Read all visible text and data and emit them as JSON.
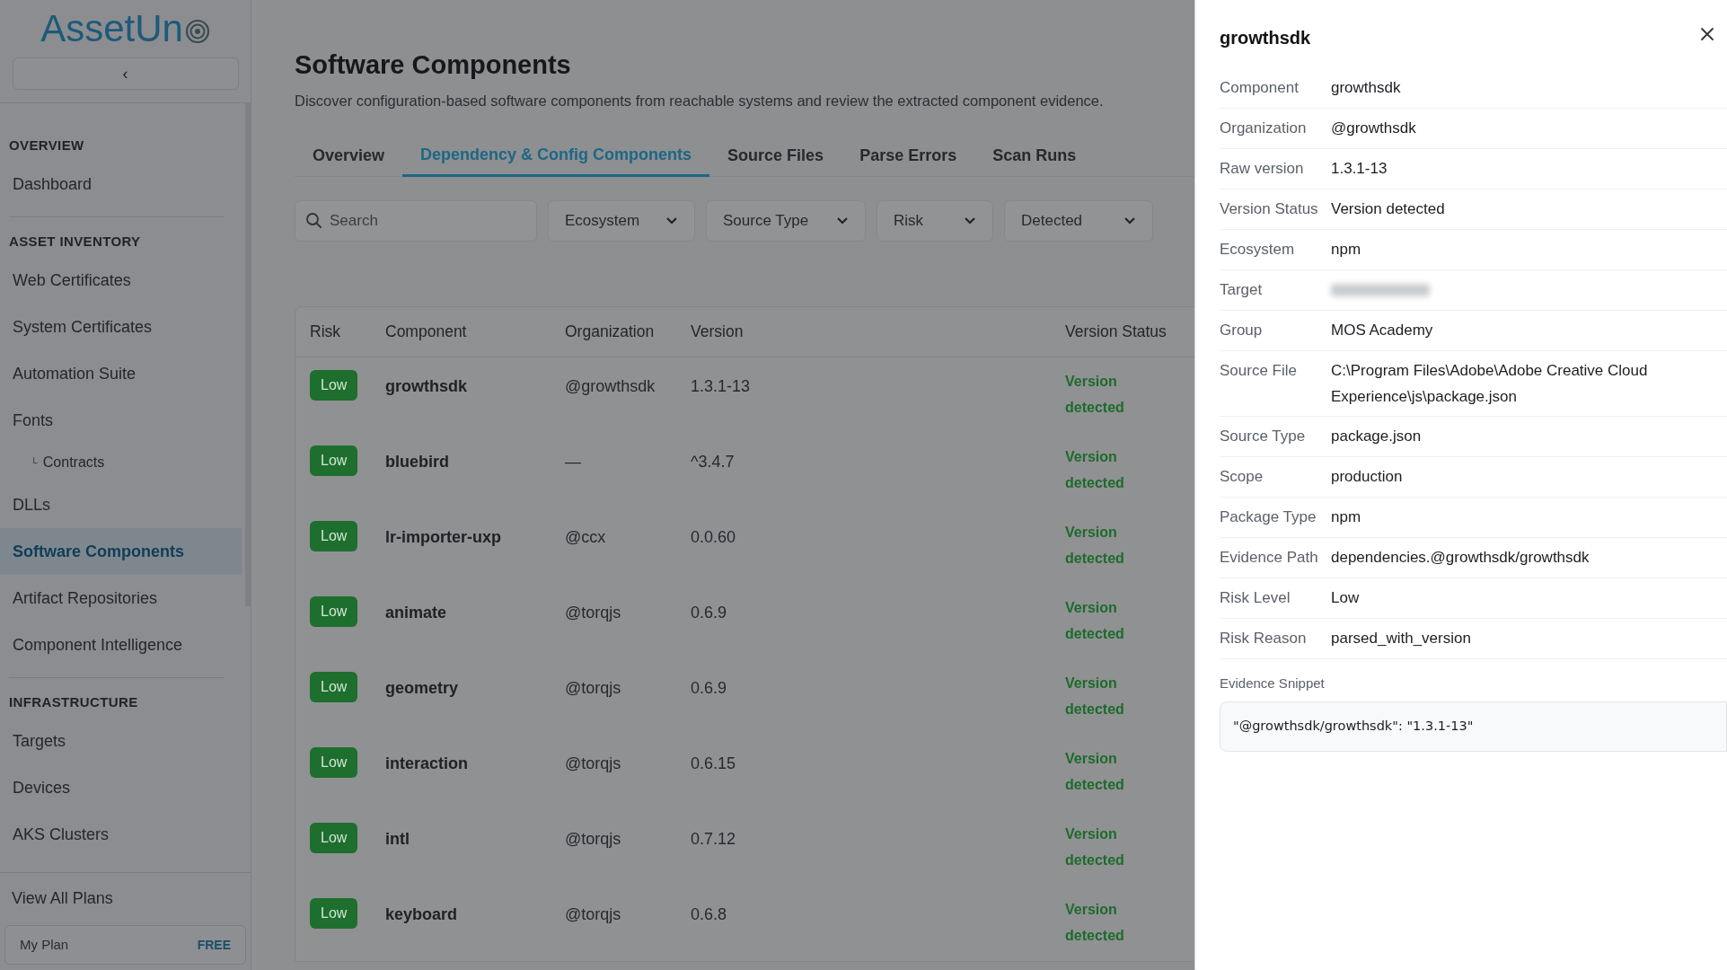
{
  "sidebar": {
    "logo": "AssetUn",
    "collapse_glyph": "‹",
    "sections": [
      {
        "heading": "OVERVIEW",
        "items": [
          {
            "label": "Dashboard",
            "selected": false
          }
        ]
      },
      {
        "heading": "ASSET INVENTORY",
        "items": [
          {
            "label": "Web Certificates",
            "selected": false
          },
          {
            "label": "System Certificates",
            "selected": false
          },
          {
            "label": "Automation Suite",
            "selected": false
          },
          {
            "label": "Fonts",
            "selected": false,
            "children": [
              {
                "label": "Contracts",
                "marker": "└",
                "selected": false
              }
            ]
          },
          {
            "label": "DLLs",
            "selected": false
          },
          {
            "label": "Software Components",
            "selected": true
          },
          {
            "label": "Artifact Repositories",
            "selected": false
          },
          {
            "label": "Component Intelligence",
            "selected": false
          }
        ]
      },
      {
        "heading": "INFRASTRUCTURE",
        "items": [
          {
            "label": "Targets",
            "selected": false
          },
          {
            "label": "Devices",
            "selected": false
          },
          {
            "label": "AKS Clusters",
            "selected": false
          }
        ]
      }
    ],
    "footer_link": "View All Plans",
    "plan": {
      "label": "My Plan",
      "badge": "FREE"
    }
  },
  "page": {
    "title": "Software Components",
    "subtitle": "Discover configuration-based software components from reachable systems and review the extracted component evidence.",
    "tabs": [
      {
        "label": "Overview",
        "selected": false
      },
      {
        "label": "Dependency & Config Components",
        "selected": true
      },
      {
        "label": "Source Files",
        "selected": false
      },
      {
        "label": "Parse Errors",
        "selected": false
      },
      {
        "label": "Scan Runs",
        "selected": false
      }
    ],
    "search": {
      "placeholder": "Search"
    },
    "filters": [
      "Ecosystem",
      "Source Type",
      "Risk",
      "Detected"
    ]
  },
  "table": {
    "columns": [
      "Risk",
      "Component",
      "Organization",
      "Version",
      "Version Status"
    ],
    "rows": [
      {
        "risk": "Low",
        "component": "growthsdk",
        "organization": "@growthsdk",
        "version": "1.3.1-13",
        "status": "Version detected"
      },
      {
        "risk": "Low",
        "component": "bluebird",
        "organization": "—",
        "version": "^3.4.7",
        "status": "Version detected"
      },
      {
        "risk": "Low",
        "component": "lr-importer-uxp",
        "organization": "@ccx",
        "version": "0.0.60",
        "status": "Version detected"
      },
      {
        "risk": "Low",
        "component": "animate",
        "organization": "@torqjs",
        "version": "0.6.9",
        "status": "Version detected"
      },
      {
        "risk": "Low",
        "component": "geometry",
        "organization": "@torqjs",
        "version": "0.6.9",
        "status": "Version detected"
      },
      {
        "risk": "Low",
        "component": "interaction",
        "organization": "@torqjs",
        "version": "0.6.15",
        "status": "Version detected"
      },
      {
        "risk": "Low",
        "component": "intl",
        "organization": "@torqjs",
        "version": "0.7.12",
        "status": "Version detected"
      },
      {
        "risk": "Low",
        "component": "keyboard",
        "organization": "@torqjs",
        "version": "0.6.8",
        "status": "Version detected"
      }
    ]
  },
  "drawer": {
    "title": "growthsdk",
    "fields": [
      {
        "label": "Component",
        "value": "growthsdk"
      },
      {
        "label": "Organization",
        "value": "@growthsdk"
      },
      {
        "label": "Raw version",
        "value": "1.3.1-13"
      },
      {
        "label": "Version Status",
        "value": "Version detected"
      },
      {
        "label": "Ecosystem",
        "value": "npm"
      },
      {
        "label": "Target",
        "redacted": true
      },
      {
        "label": "Group",
        "value": "MOS Academy"
      },
      {
        "label": "Source File",
        "value": "C:\\Program Files\\Adobe\\Adobe Creative Cloud Experience\\js\\package.json"
      },
      {
        "label": "Source Type",
        "value": "package.json"
      },
      {
        "label": "Scope",
        "value": "production"
      },
      {
        "label": "Package Type",
        "value": "npm"
      },
      {
        "label": "Evidence Path",
        "value": "dependencies.@growthsdk/growthsdk"
      },
      {
        "label": "Risk Level",
        "value": "Low"
      },
      {
        "label": "Risk Reason",
        "value": "parsed_with_version"
      }
    ],
    "snippet_label": "Evidence Snippet",
    "snippet": "\"@growthsdk/growthsdk\": \"1.3.1-13\""
  }
}
